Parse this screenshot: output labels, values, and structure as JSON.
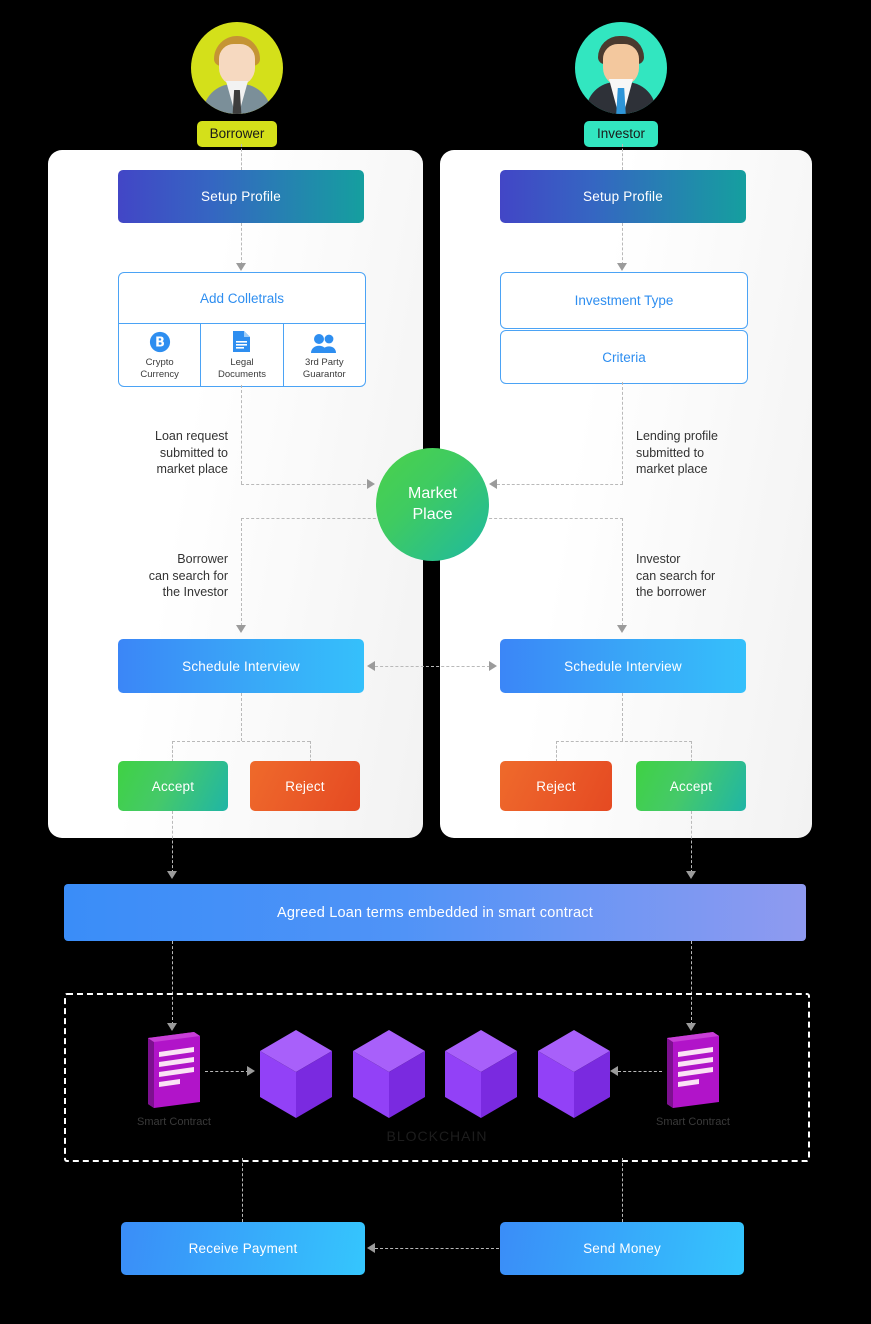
{
  "diagram": {
    "title": "P2P Lending Blockchain Flow",
    "actors": {
      "borrower": {
        "label": "Borrower",
        "pill_color": "#d4e01a",
        "avatar_bg": "#d4e01a",
        "icon": "borrower-avatar-icon"
      },
      "investor": {
        "label": "Investor",
        "pill_color": "#32e6c0",
        "avatar_bg": "#32e6c0",
        "icon": "investor-avatar-icon"
      }
    },
    "borrower_flow": {
      "setup_profile": "Setup Profile",
      "collaterals_title": "Add Colletrals",
      "collaterals": [
        {
          "label": "Crypto\nCurrency",
          "line1": "Crypto",
          "line2": "Currency",
          "icon": "bitcoin-icon"
        },
        {
          "label": "Legal\nDocuments",
          "line1": "Legal",
          "line2": "Documents",
          "icon": "document-icon"
        },
        {
          "label": "3rd Party\nGuarantor",
          "line1": "3rd Party",
          "line2": "Guarantor",
          "icon": "people-icon"
        }
      ],
      "note_to_market": "Loan request\nsubmitted to\nmarket place",
      "note_to_market_lines": [
        "Loan request",
        "submitted to",
        "market place"
      ],
      "note_search": "Borrower\ncan search for\nthe Investor",
      "note_search_lines": [
        "Borrower",
        "can search for",
        "the Investor"
      ],
      "schedule_interview": "Schedule Interview",
      "decision_left": "Accept",
      "decision_right": "Reject"
    },
    "investor_flow": {
      "setup_profile": "Setup Profile",
      "investment_type": "Investment Type",
      "criteria": "Criteria",
      "note_to_market": "Lending profile\nsubmitted to\nmarket place",
      "note_to_market_lines": [
        "Lending profile",
        "submitted to",
        "market place"
      ],
      "note_search": "Investor\ncan search for\nthe borrower",
      "note_search_lines": [
        "Investor",
        "can search for",
        "the borrower"
      ],
      "schedule_interview": "Schedule Interview",
      "decision_left": "Reject",
      "decision_right": "Accept"
    },
    "market_place": {
      "line1": "Market",
      "line2": "Place",
      "color": "#3fcb61"
    },
    "smart_contract_bar": "Agreed Loan terms embedded in smart contract",
    "blockchain": {
      "label": "BLOCKCHAIN",
      "left_contract_caption": "Smart Contract",
      "right_contract_caption": "Smart Contract",
      "block_count": 4,
      "block_color": "#8e3ef5",
      "contract_color": "#b114c9"
    },
    "payments": {
      "receive": "Receive Payment",
      "send": "Send Money"
    },
    "colors": {
      "profile_start": "#4246c6",
      "profile_end": "#159f9f",
      "interview": "#3b86f7",
      "accept": "#3fd243",
      "reject": "#ea5a28",
      "contract_bar_start": "#3a8df8",
      "contract_bar_end": "#8f9af0",
      "outline_blue": "#4ba3f5",
      "dashed_gray": "#b9b9b9"
    }
  }
}
